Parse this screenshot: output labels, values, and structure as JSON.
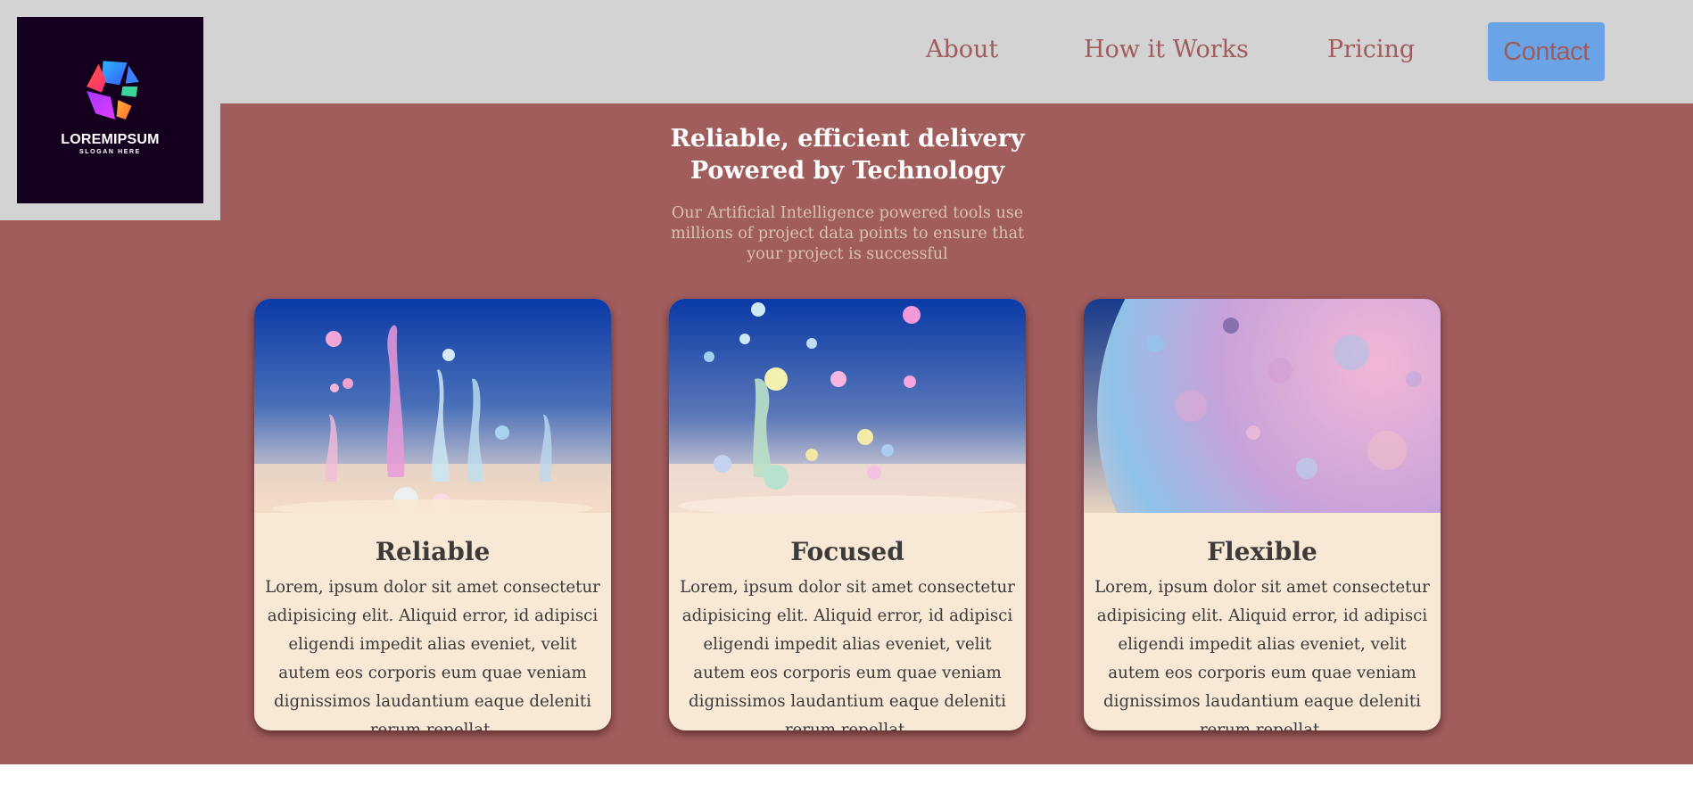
{
  "header": {
    "logo": {
      "name": "LOREMIPSUM",
      "slogan": "SLOGAN HERE"
    },
    "nav": [
      {
        "label": "About"
      },
      {
        "label": "How it Works"
      },
      {
        "label": "Pricing"
      },
      {
        "label": "Contact"
      }
    ],
    "colors": {
      "background": "#d3d3d3",
      "nav_text": "#a05c5c",
      "contact_button": "#6aa4e6"
    }
  },
  "hero": {
    "title_line1": "Reliable, efficient delivery",
    "title_line2": "Powered by Technology",
    "subtitle": "Our Artificial Intelligence powered tools use millions of project data points to ensure that your project is successful",
    "colors": {
      "background": "#a15c5c",
      "card_background": "#f8e9d7"
    }
  },
  "cards": [
    {
      "image": "paint-splash-image",
      "title": "Reliable",
      "text": "Lorem, ipsum dolor sit amet consectetur adipisicing elit. Aliquid error, id adipisci eligendi impedit alias eveniet, velit autem eos corporis eum quae veniam dignissimos laudantium eaque deleniti rerum repellat."
    },
    {
      "image": "paint-droplets-image",
      "title": "Focused",
      "text": "Lorem, ipsum dolor sit amet consectetur adipisicing elit. Aliquid error, id adipisci eligendi impedit alias eveniet, velit autem eos corporis eum quae veniam dignissimos laudantium eaque deleniti rerum repellat."
    },
    {
      "image": "moon-image",
      "title": "Flexible",
      "text": "Lorem, ipsum dolor sit amet consectetur adipisicing elit. Aliquid error, id adipisci eligendi impedit alias eveniet, velit autem eos corporis eum quae veniam dignissimos laudantium eaque deleniti rerum repellat."
    }
  ]
}
